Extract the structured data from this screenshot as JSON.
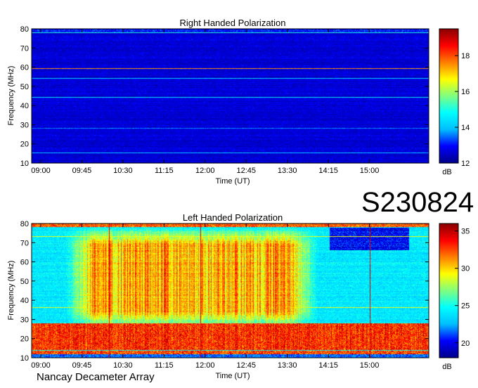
{
  "figure_id": "S230824",
  "footer": "Nancay Decameter Array",
  "chart_data": [
    {
      "type": "heatmap",
      "title": "Right Handed Polarization",
      "xlabel": "Time (UT)",
      "ylabel": "Frequency (MHz)",
      "x_ticks": [
        "09:00",
        "09:45",
        "10:30",
        "11:15",
        "12:00",
        "12:45",
        "13:30",
        "14:15",
        "15:00"
      ],
      "xlim": [
        "08:50",
        "16:05"
      ],
      "y_ticks": [
        10,
        20,
        30,
        40,
        50,
        60,
        70,
        80
      ],
      "ylim": [
        10,
        80
      ],
      "colorbar": {
        "label": "dB",
        "ticks": [
          12,
          14,
          16,
          18
        ],
        "range": [
          12,
          19.5
        ],
        "colors": [
          "#00008b",
          "#0000ff",
          "#00bfff",
          "#00ffff",
          "#80ff80",
          "#ffff00",
          "#ff8000",
          "#ff0000",
          "#8b0000"
        ]
      },
      "description_levels": {
        "background_db": 12.6,
        "peak_db": 19.3
      },
      "features": [
        {
          "kind": "interference-line",
          "freq_mhz": 59.5,
          "level_db": 17.5
        },
        {
          "kind": "interference-line",
          "freq_mhz": 54.5,
          "level_db": 14.2
        },
        {
          "kind": "interference-line",
          "freq_mhz": 44.5,
          "level_db": 14.5
        },
        {
          "kind": "interference-line",
          "freq_mhz": 28.5,
          "level_db": 13.6
        },
        {
          "kind": "interference-line",
          "freq_mhz": 15.5,
          "level_db": 14.0
        },
        {
          "kind": "interference-line",
          "freq_mhz": 78.0,
          "level_db": 15.0
        }
      ]
    },
    {
      "type": "heatmap",
      "title": "Left Handed Polarization",
      "xlabel": "Time (UT)",
      "ylabel": "Frequency (MHz)",
      "x_ticks": [
        "09:00",
        "09:45",
        "10:30",
        "11:15",
        "12:00",
        "12:45",
        "13:30",
        "14:15",
        "15:00"
      ],
      "xlim": [
        "08:50",
        "16:05"
      ],
      "y_ticks": [
        10,
        20,
        30,
        40,
        50,
        60,
        70,
        80
      ],
      "ylim": [
        10,
        80
      ],
      "colorbar": {
        "label": "dB",
        "ticks": [
          20,
          25,
          30,
          35
        ],
        "range": [
          18,
          36
        ],
        "colors": [
          "#00008b",
          "#0000ff",
          "#00bfff",
          "#00ffff",
          "#80ff80",
          "#ffff00",
          "#ff8000",
          "#ff0000",
          "#8b0000"
        ]
      },
      "description_levels": {
        "background_db": 24,
        "peak_db": 35
      },
      "features": [
        {
          "kind": "broad-emission",
          "time_from": "09:50",
          "time_to": "13:40",
          "freq_from_mhz": 28,
          "freq_to_mhz": 75,
          "level_db": 31
        },
        {
          "kind": "low-band",
          "freq_from_mhz": 14,
          "freq_to_mhz": 28,
          "level_db": 34
        },
        {
          "kind": "interference-line",
          "freq_mhz": 73.5,
          "level_db": 29
        },
        {
          "kind": "interference-line",
          "freq_mhz": 36.5,
          "level_db": 29
        },
        {
          "kind": "vertical-line",
          "time": "10:15"
        },
        {
          "kind": "vertical-line",
          "time": "11:55"
        },
        {
          "kind": "vertical-line",
          "time": "15:00"
        }
      ]
    }
  ]
}
